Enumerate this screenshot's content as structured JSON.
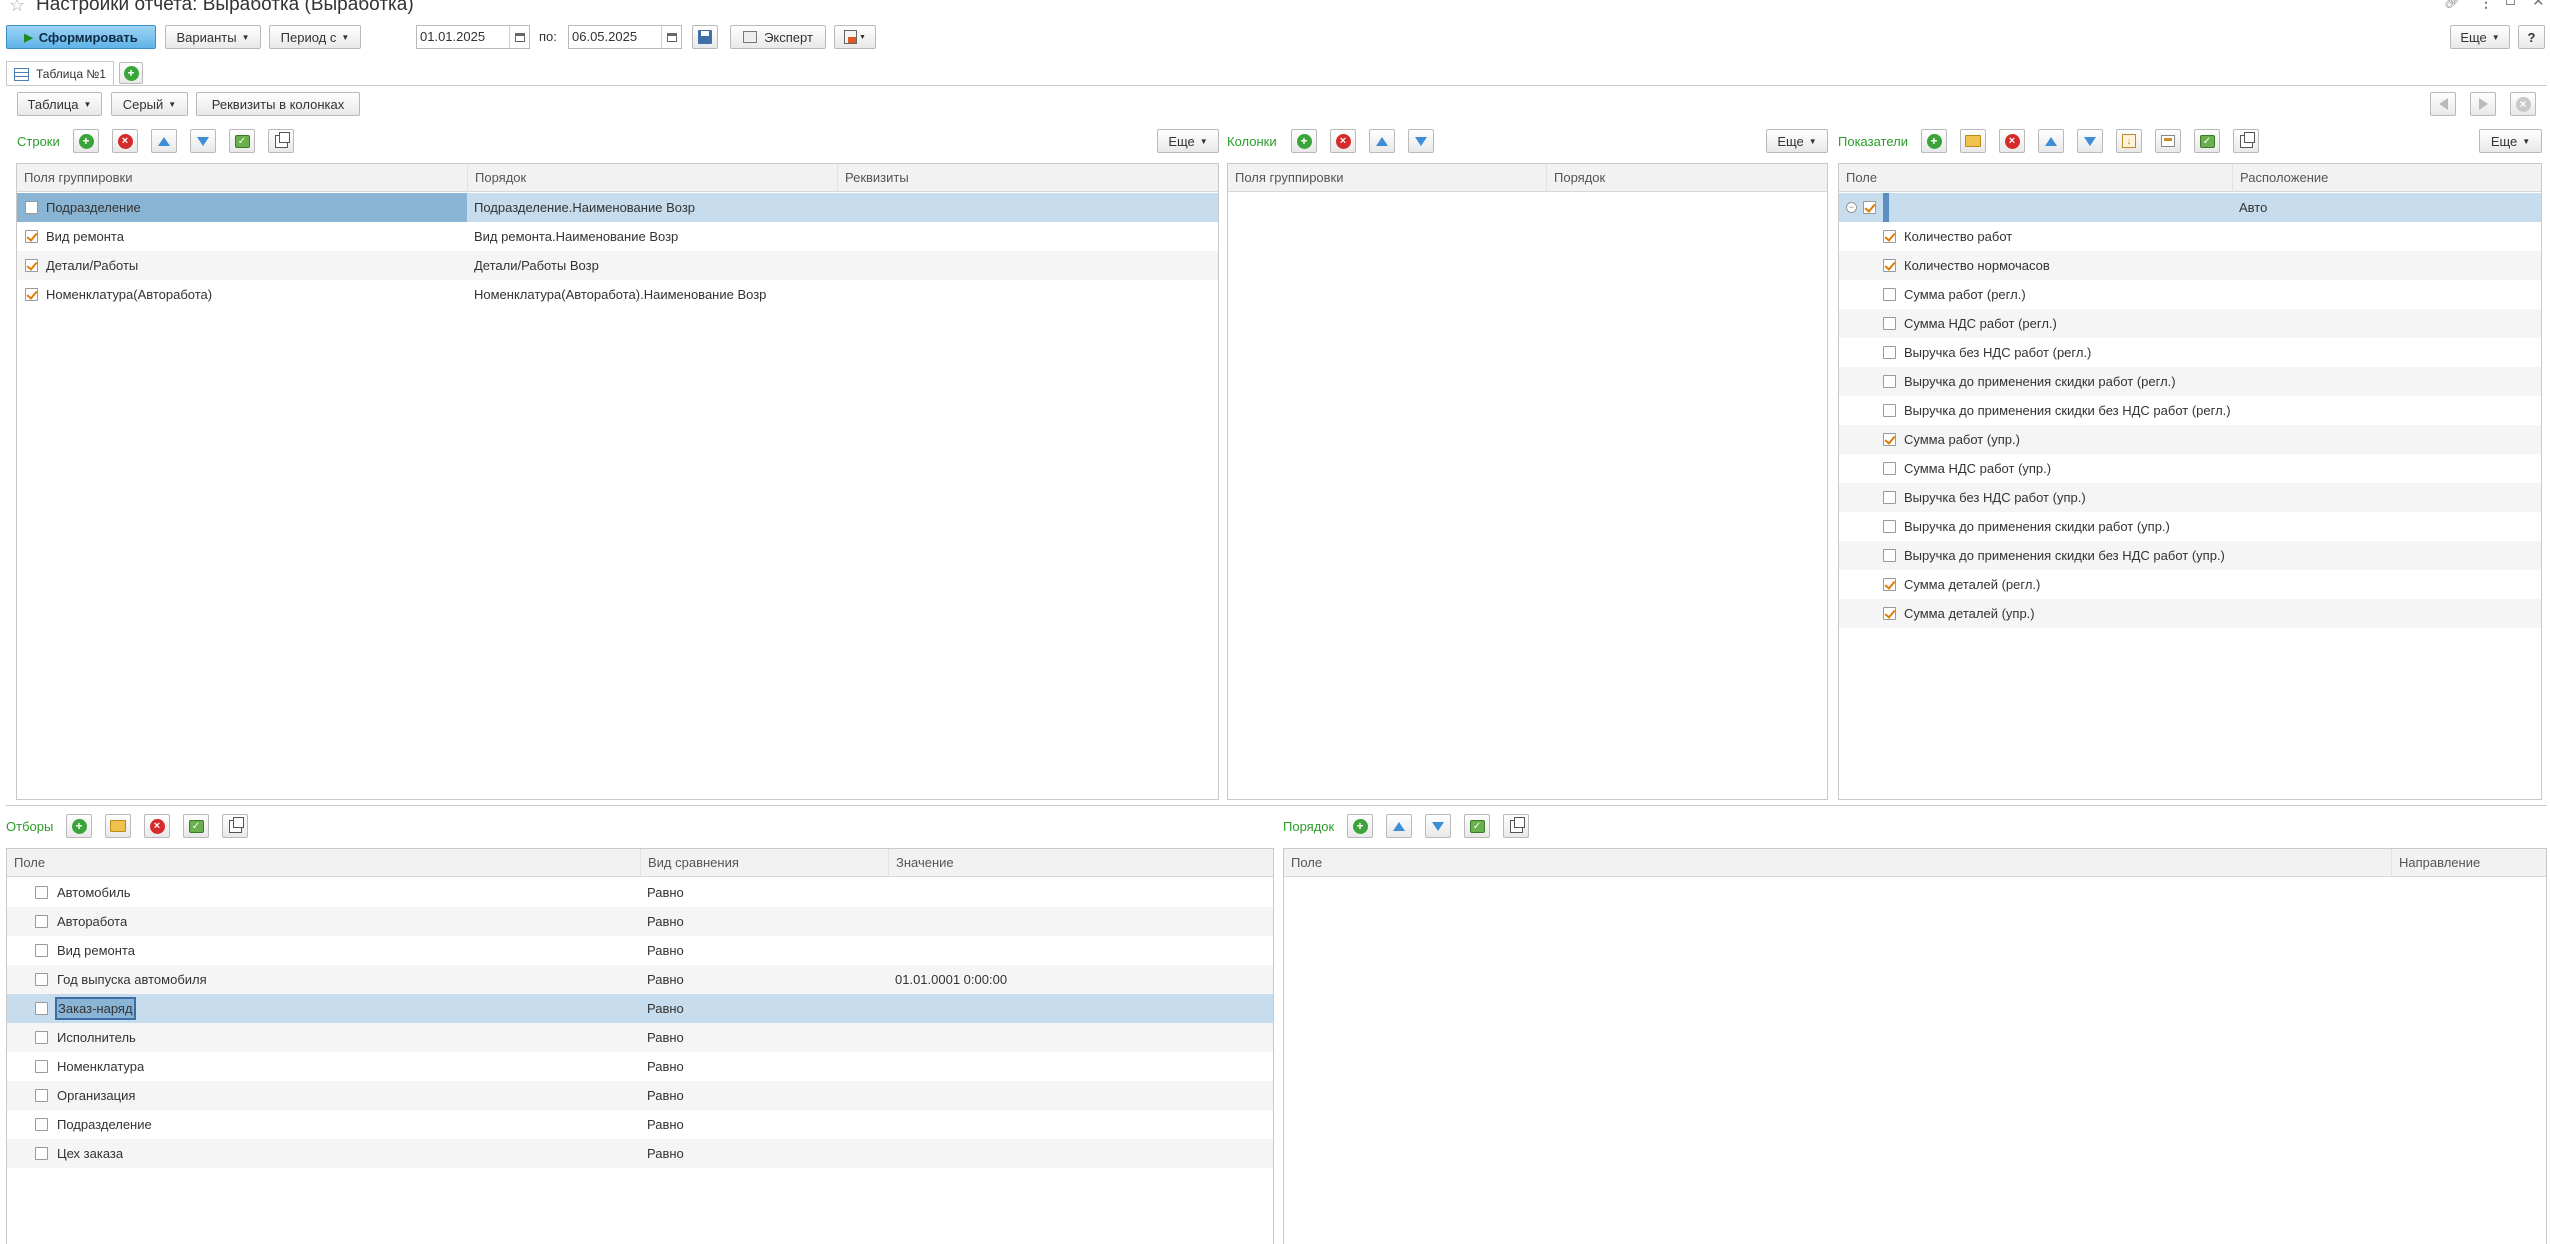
{
  "window": {
    "title": "Настройки отчета: Выработка (Выработка)"
  },
  "toolbar": {
    "generate": "Сформировать",
    "variants": "Варианты",
    "period_from": "Период с",
    "date_from": "01.01.2025",
    "to_label": "по:",
    "date_to": "06.05.2025",
    "expert": "Эксперт",
    "more": "Еще",
    "help": "?"
  },
  "tabs": [
    {
      "label": "Таблица №1"
    }
  ],
  "subtoolbar": {
    "table": "Таблица",
    "gray": "Серый",
    "requisites_in_columns": "Реквизиты в колонках"
  },
  "rows_section": {
    "label": "Строки",
    "more": "Еще",
    "columns": [
      "Поля группировки",
      "Порядок",
      "Реквизиты"
    ],
    "items": [
      {
        "field": "Подразделение",
        "order": "Подразделение.Наименование Возр",
        "checked": false,
        "selected": true
      },
      {
        "field": "Вид ремонта",
        "order": "Вид ремонта.Наименование Возр",
        "checked": true
      },
      {
        "field": "Детали/Работы",
        "order": "Детали/Работы Возр",
        "checked": true
      },
      {
        "field": "Номенклатура(Авторабота)",
        "order": "Номенклатура(Авторабота).Наименование Возр",
        "checked": true
      }
    ]
  },
  "columns_section": {
    "label": "Колонки",
    "more": "Еще",
    "columns": [
      "Поля группировки",
      "Порядок"
    ]
  },
  "indicators_section": {
    "label": "Показатели",
    "more": "Еще",
    "columns": [
      "Поле",
      "Расположение"
    ],
    "root_location": "Авто",
    "items": [
      {
        "name": "Количество работ",
        "checked": true
      },
      {
        "name": "Количество нормочасов",
        "checked": true
      },
      {
        "name": "Сумма работ (регл.)",
        "checked": false
      },
      {
        "name": "Сумма НДС работ (регл.)",
        "checked": false
      },
      {
        "name": "Выручка без НДС работ (регл.)",
        "checked": false
      },
      {
        "name": "Выручка до применения скидки работ (регл.)",
        "checked": false
      },
      {
        "name": "Выручка до применения скидки без НДС работ (регл.)",
        "checked": false
      },
      {
        "name": "Сумма работ (упр.)",
        "checked": true
      },
      {
        "name": "Сумма НДС работ (упр.)",
        "checked": false
      },
      {
        "name": "Выручка без НДС работ (упр.)",
        "checked": false
      },
      {
        "name": "Выручка до применения скидки работ (упр.)",
        "checked": false
      },
      {
        "name": "Выручка до применения скидки без НДС работ (упр.)",
        "checked": false
      },
      {
        "name": "Сумма деталей (регл.)",
        "checked": true
      },
      {
        "name": "Сумма деталей (упр.)",
        "checked": true
      }
    ]
  },
  "filters_section": {
    "label": "Отборы",
    "columns": [
      "Поле",
      "Вид сравнения",
      "Значение"
    ],
    "items": [
      {
        "field": "Автомобиль",
        "comparison": "Равно",
        "value": ""
      },
      {
        "field": "Авторабота",
        "comparison": "Равно",
        "value": ""
      },
      {
        "field": "Вид ремонта",
        "comparison": "Равно",
        "value": ""
      },
      {
        "field": "Год выпуска автомобиля",
        "comparison": "Равно",
        "value": "01.01.0001 0:00:00"
      },
      {
        "field": "Заказ-наряд",
        "comparison": "Равно",
        "value": "",
        "selected": true
      },
      {
        "field": "Исполнитель",
        "comparison": "Равно",
        "value": ""
      },
      {
        "field": "Номенклатура",
        "comparison": "Равно",
        "value": ""
      },
      {
        "field": "Организация",
        "comparison": "Равно",
        "value": ""
      },
      {
        "field": "Подразделение",
        "comparison": "Равно",
        "value": ""
      },
      {
        "field": "Цех заказа",
        "comparison": "Равно",
        "value": ""
      }
    ]
  },
  "order_section": {
    "label": "Порядок",
    "columns": [
      "Поле",
      "Направление"
    ]
  },
  "colors": {
    "accent_green": "#2a9d2a",
    "selection": "#c7dcec",
    "selection_dark": "#8ab4d4",
    "primary_button": "#5fb3e8"
  }
}
